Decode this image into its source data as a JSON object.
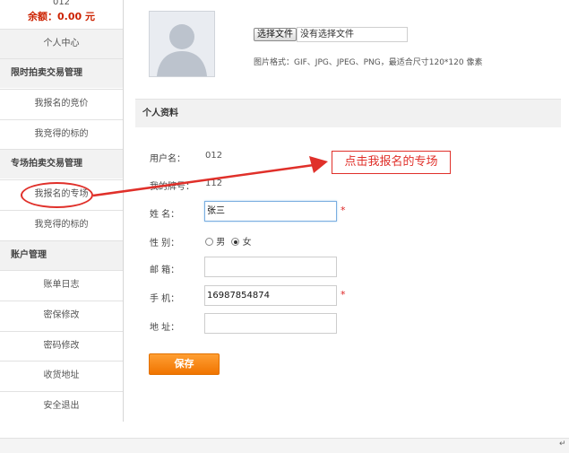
{
  "sidebar": {
    "user_number": "012",
    "balance": "余额：0.00 元",
    "items": [
      {
        "label": "个人中心",
        "type": "item"
      },
      {
        "label": "限时拍卖交易管理",
        "type": "section"
      },
      {
        "label": "我报名的竞价",
        "type": "item"
      },
      {
        "label": "我竞得的标的",
        "type": "item"
      },
      {
        "label": "专场拍卖交易管理",
        "type": "section"
      },
      {
        "label": "我报名的专场",
        "type": "item"
      },
      {
        "label": "我竞得的标的",
        "type": "item"
      },
      {
        "label": "账户管理",
        "type": "section"
      },
      {
        "label": "账单日志",
        "type": "item"
      },
      {
        "label": "密保修改",
        "type": "item"
      },
      {
        "label": "密码修改",
        "type": "item"
      },
      {
        "label": "收货地址",
        "type": "item"
      },
      {
        "label": "安全退出",
        "type": "item"
      }
    ]
  },
  "upload": {
    "button_label": "选择文件",
    "status": "没有选择文件",
    "format_hint": "图片格式：GIF、JPG、JPEG、PNG，最适合尺寸120*120 像素"
  },
  "profile": {
    "section_title": "个人资料",
    "username_label": "用户名：",
    "username_value": "012",
    "bid_number_label": "我的牌号：",
    "bid_number_value": "112",
    "name_label": "姓 名：",
    "name_value": "张三",
    "gender_label": "性 别：",
    "gender_options": [
      "男",
      "女"
    ],
    "gender_selected": "女",
    "email_label": "邮 箱：",
    "email_value": "",
    "phone_label": "手 机：",
    "phone_value": "16987854874",
    "address_label": "地 址：",
    "address_value": "",
    "required_mark": "*",
    "save_label": "保存"
  },
  "annotation": {
    "callout_text": "点击我报名的专场",
    "color": "#e0302a"
  },
  "colors": {
    "accent_orange": "#f07400",
    "balance_red": "#cc2200",
    "section_bg": "#f1f1f1"
  }
}
